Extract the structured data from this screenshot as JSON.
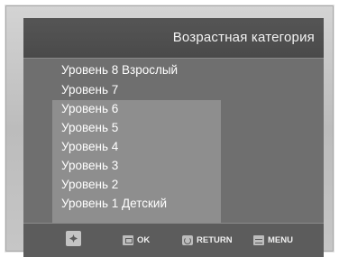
{
  "header": {
    "title": "Возрастная категория"
  },
  "menu": {
    "items": [
      {
        "label": "Уровень 8 Взрослый"
      },
      {
        "label": "Уровень 7"
      },
      {
        "label": "Уровень 6"
      },
      {
        "label": "Уровень 5"
      },
      {
        "label": "Уровень 4"
      },
      {
        "label": "Уровень 3"
      },
      {
        "label": "Уровень 2"
      },
      {
        "label": "Уровень 1 Детский"
      }
    ],
    "highlighted_range": "Уровень 6 – Уровень 1 Детский"
  },
  "footer": {
    "nav_icon": "navigate-arrows-icon",
    "ok_label": "OK",
    "return_label": "RETURN",
    "menu_label": "MENU"
  },
  "colors": {
    "screen_bg": "#6f6f6f",
    "titlebar_bg": "#4f4f4f",
    "highlight_bg": "#8e8e8e",
    "bezel": "#c8c8c8",
    "text": "#ffffff"
  }
}
